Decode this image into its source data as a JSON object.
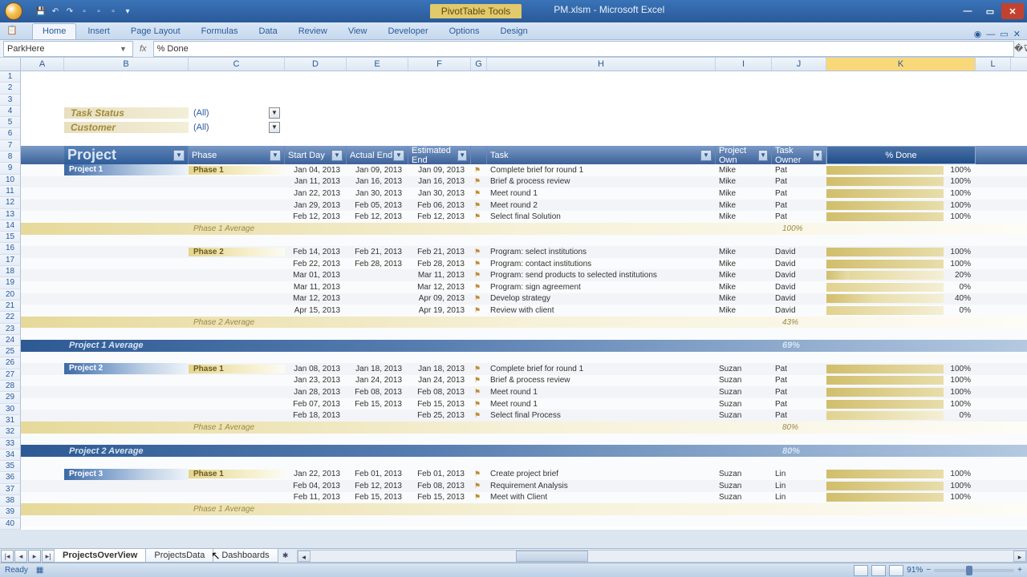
{
  "title": {
    "contextTab": "PivotTable Tools",
    "fileApp": "PM.xlsm  -  Microsoft Excel"
  },
  "ribbon": {
    "tabs": [
      "Home",
      "Insert",
      "Page Layout",
      "Formulas",
      "Data",
      "Review",
      "View",
      "Developer",
      "Options",
      "Design"
    ],
    "active": 0
  },
  "namebox": "ParkHere",
  "formula": "% Done",
  "columns": [
    "A",
    "B",
    "C",
    "D",
    "E",
    "F",
    "G",
    "H",
    "I",
    "J",
    "K",
    "L"
  ],
  "selectedCol": "K",
  "rowCount": 40,
  "filters": [
    {
      "label": "Task Status",
      "value": "(All)"
    },
    {
      "label": "Customer",
      "value": "(All)"
    }
  ],
  "headers": {
    "project": "Project",
    "phase": "Phase",
    "start": "Start Day",
    "actual": "Actual End",
    "est": "Estimated End",
    "task": "Task",
    "owner": "Project Own",
    "towner": "Task Owner",
    "done": "% Done"
  },
  "rows": [
    {
      "t": "data",
      "proj": "Project 1",
      "phase": "Phase 1",
      "start": "Jan 04, 2013",
      "actual": "Jan 09, 2013",
      "est": "Jan 09, 2013",
      "task": "Complete brief for round 1",
      "own": "Mike",
      "town": "Pat",
      "pct": "100%",
      "fill": 100
    },
    {
      "t": "data",
      "start": "Jan 11, 2013",
      "actual": "Jan 16, 2013",
      "est": "Jan 16, 2013",
      "task": "Brief & process review",
      "own": "Mike",
      "town": "Pat",
      "pct": "100%",
      "fill": 100
    },
    {
      "t": "data",
      "start": "Jan 22, 2013",
      "actual": "Jan 30, 2013",
      "est": "Jan 30, 2013",
      "task": "Meet  round 1",
      "own": "Mike",
      "town": "Pat",
      "pct": "100%",
      "fill": 100
    },
    {
      "t": "data",
      "start": "Jan 29, 2013",
      "actual": "Feb 05, 2013",
      "est": "Feb 06, 2013",
      "task": "Meet round 2",
      "own": "Mike",
      "town": "Pat",
      "pct": "100%",
      "fill": 100
    },
    {
      "t": "data",
      "start": "Feb 12, 2013",
      "actual": "Feb 12, 2013",
      "est": "Feb 12, 2013",
      "task": "Select final Solution",
      "own": "Mike",
      "town": "Pat",
      "pct": "100%",
      "fill": 100
    },
    {
      "t": "phavg",
      "label": "Phase 1 Average",
      "pct": "100%"
    },
    {
      "t": "blank"
    },
    {
      "t": "data",
      "phase": "Phase 2",
      "start": "Feb 14, 2013",
      "actual": "Feb 21, 2013",
      "est": "Feb 21, 2013",
      "task": "Program:  select  institutions",
      "own": "Mike",
      "town": "David",
      "pct": "100%",
      "fill": 100
    },
    {
      "t": "data",
      "start": "Feb 22, 2013",
      "actual": "Feb 28, 2013",
      "est": "Feb 28, 2013",
      "task": "Program: contact institutions",
      "own": "Mike",
      "town": "David",
      "pct": "100%",
      "fill": 100
    },
    {
      "t": "data",
      "start": "Mar 01, 2013",
      "est": "Mar 11, 2013",
      "task": "Program: send products to selected institutions",
      "own": "Mike",
      "town": "David",
      "pct": "20%",
      "fill": 20
    },
    {
      "t": "data",
      "start": "Mar 11, 2013",
      "est": "Mar 12, 2013",
      "task": "Program: sign agreement",
      "own": "Mike",
      "town": "David",
      "pct": "0%",
      "fill": 0
    },
    {
      "t": "data",
      "start": "Mar 12, 2013",
      "est": "Apr 09, 2013",
      "task": "Develop strategy",
      "own": "Mike",
      "town": "David",
      "pct": "40%",
      "fill": 40
    },
    {
      "t": "data",
      "start": "Apr 15, 2013",
      "est": "Apr 19, 2013",
      "task": "Review with client",
      "own": "Mike",
      "town": "David",
      "pct": "0%",
      "fill": 0
    },
    {
      "t": "phavg",
      "label": "Phase 2 Average",
      "pct": "43%"
    },
    {
      "t": "blank"
    },
    {
      "t": "pravg",
      "label": "Project 1 Average",
      "pct": "69%"
    },
    {
      "t": "blank"
    },
    {
      "t": "data",
      "proj": "Project 2",
      "phase": "Phase 1",
      "start": "Jan 08, 2013",
      "actual": "Jan 18, 2013",
      "est": "Jan 18, 2013",
      "task": "Complete brief for round 1",
      "own": "Suzan",
      "town": "Pat",
      "pct": "100%",
      "fill": 100
    },
    {
      "t": "data",
      "start": "Jan 23, 2013",
      "actual": "Jan 24, 2013",
      "est": "Jan 24, 2013",
      "task": "Brief & process review",
      "own": "Suzan",
      "town": "Pat",
      "pct": "100%",
      "fill": 100
    },
    {
      "t": "data",
      "start": "Jan 28, 2013",
      "actual": "Feb 08, 2013",
      "est": "Feb 08, 2013",
      "task": "Meet  round 1",
      "own": "Suzan",
      "town": "Pat",
      "pct": "100%",
      "fill": 100
    },
    {
      "t": "data",
      "start": "Feb 07, 2013",
      "actual": "Feb 15, 2013",
      "est": "Feb 15, 2013",
      "task": "Meet  round 1",
      "own": "Suzan",
      "town": "Pat",
      "pct": "100%",
      "fill": 100
    },
    {
      "t": "data",
      "start": "Feb 18, 2013",
      "est": "Feb 25, 2013",
      "task": "Select final Process",
      "own": "Suzan",
      "town": "Pat",
      "pct": "0%",
      "fill": 0
    },
    {
      "t": "phavg",
      "label": "Phase 1 Average",
      "pct": "80%"
    },
    {
      "t": "blank"
    },
    {
      "t": "pravg",
      "label": "Project 2 Average",
      "pct": "80%"
    },
    {
      "t": "blank"
    },
    {
      "t": "data",
      "proj": "Project 3",
      "phase": "Phase 1",
      "start": "Jan 22, 2013",
      "actual": "Feb 01, 2013",
      "est": "Feb 01, 2013",
      "task": "Create project brief",
      "own": "Suzan",
      "town": "Lin",
      "pct": "100%",
      "fill": 100
    },
    {
      "t": "data",
      "start": "Feb 04, 2013",
      "actual": "Feb 12, 2013",
      "est": "Feb 08, 2013",
      "task": "Requirement Analysis",
      "own": "Suzan",
      "town": "Lin",
      "pct": "100%",
      "fill": 100
    },
    {
      "t": "data",
      "start": "Feb 11, 2013",
      "actual": "Feb 15, 2013",
      "est": "Feb 15, 2013",
      "task": "Meet with Client",
      "own": "Suzan",
      "town": "Lin",
      "pct": "100%",
      "fill": 100
    },
    {
      "t": "phavg",
      "label": "Phase 1 Average",
      "pct": ""
    },
    {
      "t": "blank"
    }
  ],
  "sheetTabs": [
    "ProjectsOverView",
    "ProjectsData",
    "Dashboards"
  ],
  "activeSheet": 0,
  "status": {
    "ready": "Ready",
    "zoom": "91%"
  }
}
